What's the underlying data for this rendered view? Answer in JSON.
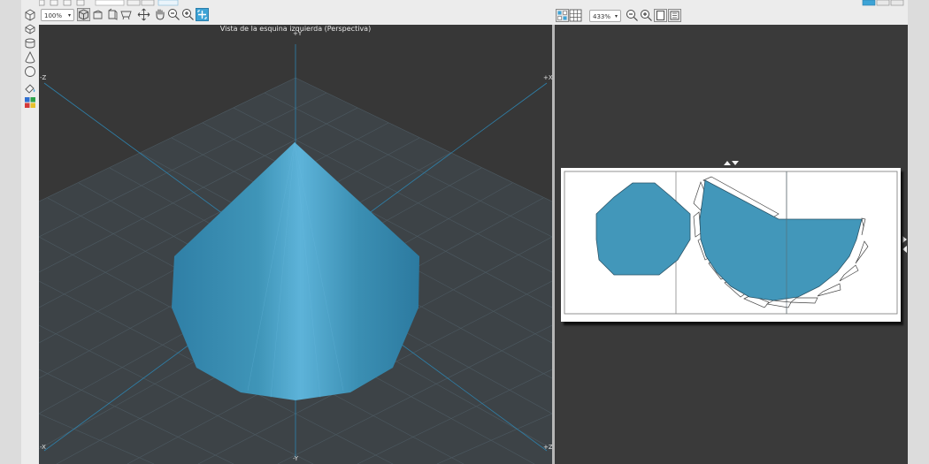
{
  "toolbar_left": {
    "zoom_value": "100%"
  },
  "toolbar_right": {
    "zoom_value": "433%"
  },
  "viewport_3d": {
    "title": "Vista de la esquina izquierda (Perspectiva)",
    "axes": {
      "top": "+Y",
      "bottom": "-Y",
      "top_left": "-Z",
      "top_right": "+X",
      "bottom_left": "-X",
      "bottom_right": "+Z"
    }
  },
  "colors": {
    "model_blue": "#3f95b8",
    "accent_select": "#3da3d6",
    "viewport_bg": "#373737"
  },
  "icons": [
    "cube-icon",
    "prism-icon",
    "cylinder-icon",
    "cone-icon",
    "sphere-icon",
    "palette-icon"
  ]
}
